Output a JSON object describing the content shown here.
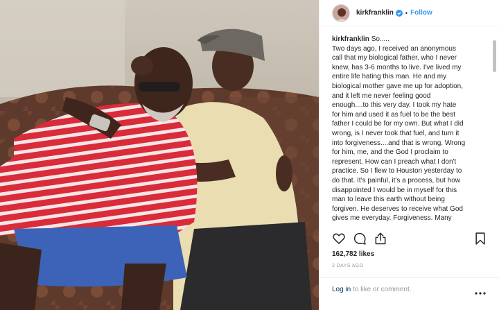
{
  "post": {
    "username": "kirkfranklin",
    "verified": true,
    "separator": "•",
    "follow_label": "Follow",
    "caption_user": "kirkfranklin",
    "caption_lines": [
      " So.....",
      "Two days ago, I received an anonymous",
      "call that my biological father, who I never",
      "knew, has 3-6 months to live. I've lived my",
      "entire life hating this man. He and my",
      "biological mother gave me up for adoption,",
      "and it left me never feeling good",
      "enough....to this very day. I took my hate",
      "for him and used it as fuel to be the best",
      "father I could be for my own. But what I did",
      "wrong, is I never took that fuel, and turn it",
      "into forgiveness....and that is wrong. Wrong",
      "for him, me, and the God I proclaim to",
      "represent. How can I preach what I don't",
      "practice. So I flew to Houston yesterday to",
      "do that. It's painful, it's a process, but how",
      "disappointed I would be in myself for this",
      "man to leave this earth without being",
      "forgiven. He deserves to receive what God",
      "gives me everyday. Forgiveness. Many"
    ],
    "likes": "162,782 likes",
    "time": "2 DAYS AGO",
    "login_link": "Log in",
    "login_rest": " to like or comment."
  },
  "icons": {
    "heart": "heart-icon",
    "comment": "comment-icon",
    "share": "share-icon",
    "save": "bookmark-icon",
    "more": "more-options-icon",
    "verified": "verified-badge-icon"
  },
  "colors": {
    "follow": "#3897f0",
    "verified": "#3897f0",
    "text": "#262626",
    "muted": "#999999",
    "link": "#003569"
  }
}
